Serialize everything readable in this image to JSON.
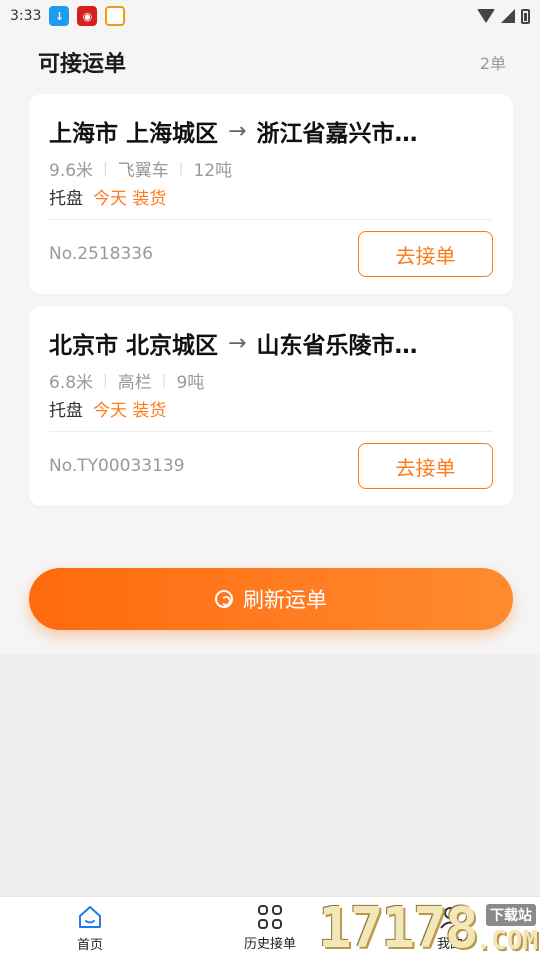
{
  "status_bar": {
    "time": "3:33"
  },
  "header": {
    "title": "可接运单",
    "count": "2单"
  },
  "orders": [
    {
      "from": "上海市 上海城区",
      "arrow": "→",
      "to": "浙江省嘉兴市…",
      "length": "9.6米",
      "vehicle": "飞翼车",
      "weight": "12吨",
      "cargo_type": "托盘",
      "load_time": "今天 装货",
      "order_no": "No.2518336",
      "accept_label": "去接单"
    },
    {
      "from": "北京市 北京城区",
      "arrow": "→",
      "to": "山东省乐陵市…",
      "length": "6.8米",
      "vehicle": "高栏",
      "weight": "9吨",
      "cargo_type": "托盘",
      "load_time": "今天 装货",
      "order_no": "No.TY00033139",
      "accept_label": "去接单"
    }
  ],
  "refresh": {
    "label": "刷新运单",
    "icon": "refresh-icon"
  },
  "tabs": [
    {
      "label": "首页",
      "icon": "home-icon",
      "active": true
    },
    {
      "label": "历史接单",
      "icon": "grid-icon",
      "active": false
    },
    {
      "label": "我的",
      "icon": "person-icon",
      "active": false
    }
  ],
  "watermark": {
    "number": "17178",
    "site": "下载站",
    "suffix": ".COM"
  },
  "colors": {
    "accent": "#ff7a1a",
    "active_tab": "#1e7be8",
    "background": "#f5f5f5"
  }
}
